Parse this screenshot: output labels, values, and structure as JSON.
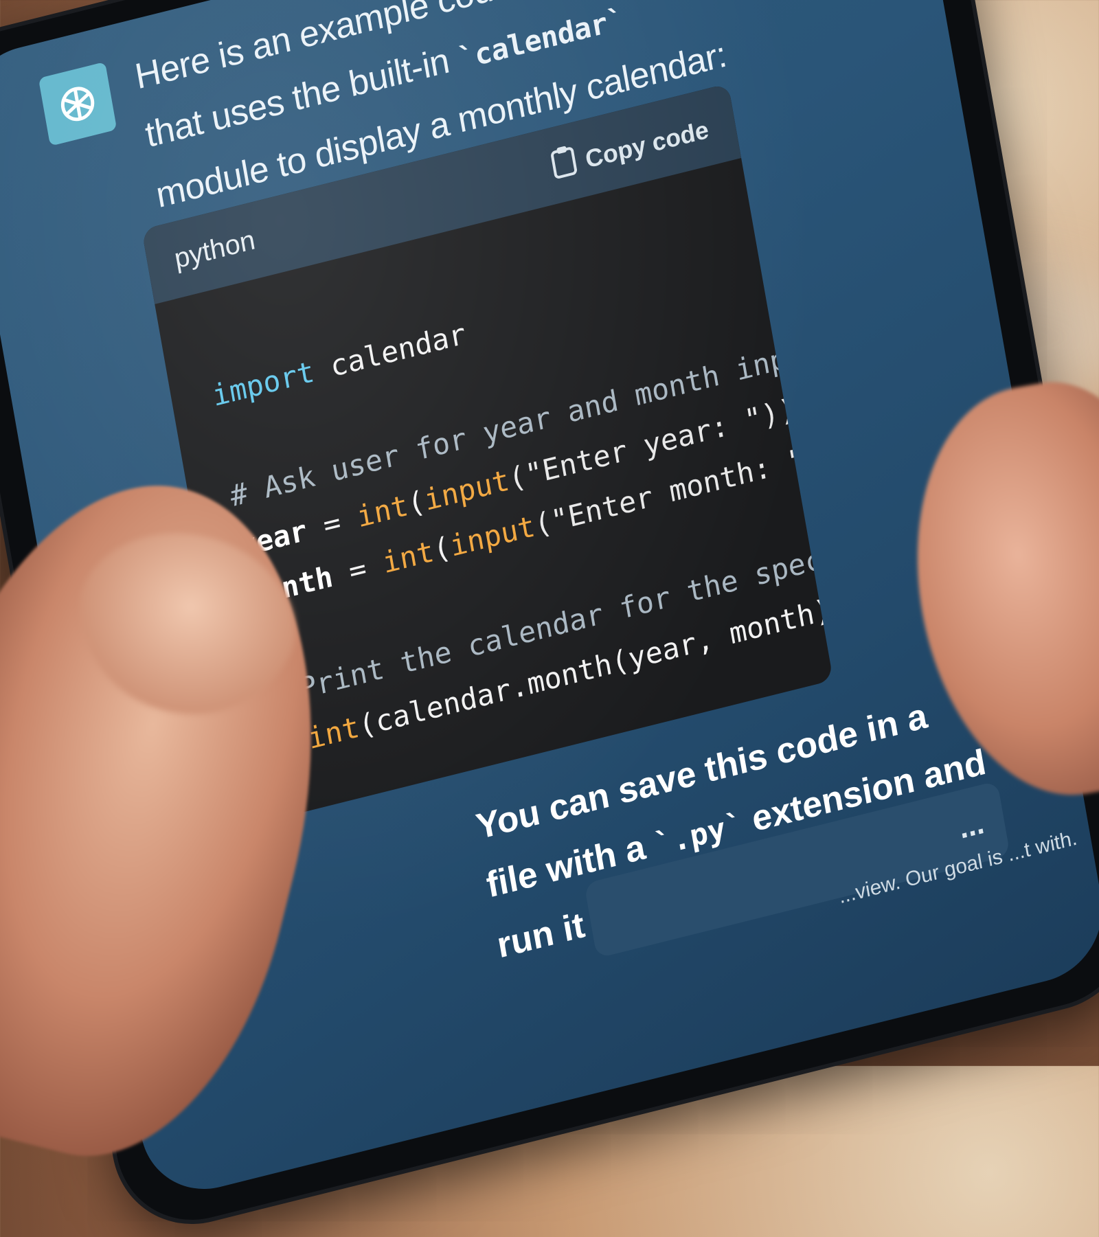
{
  "assistant": {
    "message_1": {
      "part1": "Here is an example code in Python that uses the built-in ",
      "inline_code": "`calendar`",
      "part2": " module to display a monthly calendar:"
    },
    "code_block": {
      "language": "python",
      "copy_label": "Copy code",
      "lines": [
        "import calendar",
        "",
        "# Ask user for year and month input",
        "year = int(input(\"Enter year: \"))",
        "month = int(input(\"Enter month: \"))",
        "",
        "# Print the calendar for the specified",
        "print(calendar.month(year, month))"
      ]
    },
    "message_2": {
      "part1": "You can save this code in a file with a ",
      "inline_code": "`.py`",
      "part2": " extension and run it from the"
    }
  },
  "composer": {
    "more_label": "...",
    "disclaimer": "...view. Our goal is ...t with."
  },
  "icons": {
    "avatar": "openai-logo-icon",
    "copy": "clipboard-icon",
    "scroll": "arrow-down-icon",
    "send": "square-icon"
  },
  "colors": {
    "screen_bg": "#2a5578",
    "code_bg": "#1a1b1d",
    "keyword": "#5fc7ec",
    "function": "#f2a53a",
    "comment": "#a9b7c2",
    "avatar_bg": "#5fb6cc"
  }
}
